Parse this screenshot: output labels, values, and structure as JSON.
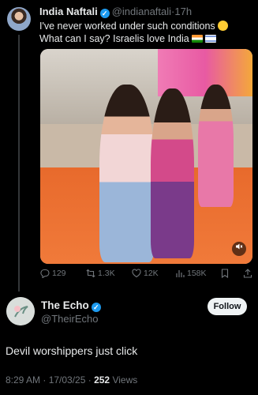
{
  "tweet": {
    "author_name": "India Naftali",
    "handle": "@indianaftali",
    "time": "17h",
    "separator": "·",
    "line1": "I've never worked under such conditions",
    "line2": "What can I say? Israelis love India",
    "actions": {
      "replies": "129",
      "reposts": "1.3K",
      "likes": "12K",
      "views": "158K"
    }
  },
  "reply": {
    "author_name": "The Echo",
    "handle": "@TheirEcho",
    "follow_label": "Follow",
    "text": "Devil worshippers just click",
    "timestamp": "8:29 AM · 17/03/25 ·",
    "views_count": "252",
    "views_label": "Views"
  },
  "colors": {
    "background": "#000000",
    "text": "#e7e9ea",
    "muted": "#71767b",
    "verified": "#1d9bf0",
    "follow_bg": "#eff3f4"
  },
  "icons": [
    "reply-icon",
    "repost-icon",
    "like-icon",
    "views-icon",
    "bookmark-icon",
    "share-icon",
    "mute-icon",
    "verified-icon"
  ]
}
